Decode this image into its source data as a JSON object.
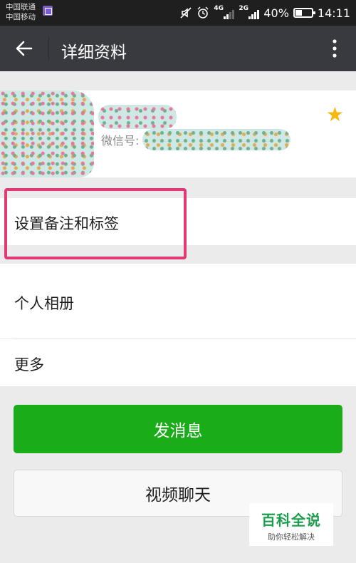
{
  "status_bar": {
    "carrier1": "中国联通",
    "carrier2": "中国移动",
    "net1": "4G",
    "net2": "2G",
    "battery": "40%",
    "time": "14:11",
    "icons": [
      "image-notification-icon",
      "mute-icon",
      "alarm-icon",
      "signal-icon",
      "battery-icon"
    ]
  },
  "title_bar": {
    "title": "详细资料",
    "icons": [
      "back-arrow-icon",
      "more-vert-icon"
    ]
  },
  "profile": {
    "wechat_id_label": "微信号:",
    "star_icon": "star-icon",
    "star_color": "#f5b80e"
  },
  "rows": {
    "remark": "设置备注和标签",
    "album": "个人相册",
    "more": "更多"
  },
  "highlight_color": "#e23876",
  "buttons": {
    "send_message": "发消息",
    "video_call": "视频聊天",
    "send_color": "#1aad19"
  },
  "watermark": {
    "title": "百科全说",
    "subtitle": "助你轻松解决"
  }
}
